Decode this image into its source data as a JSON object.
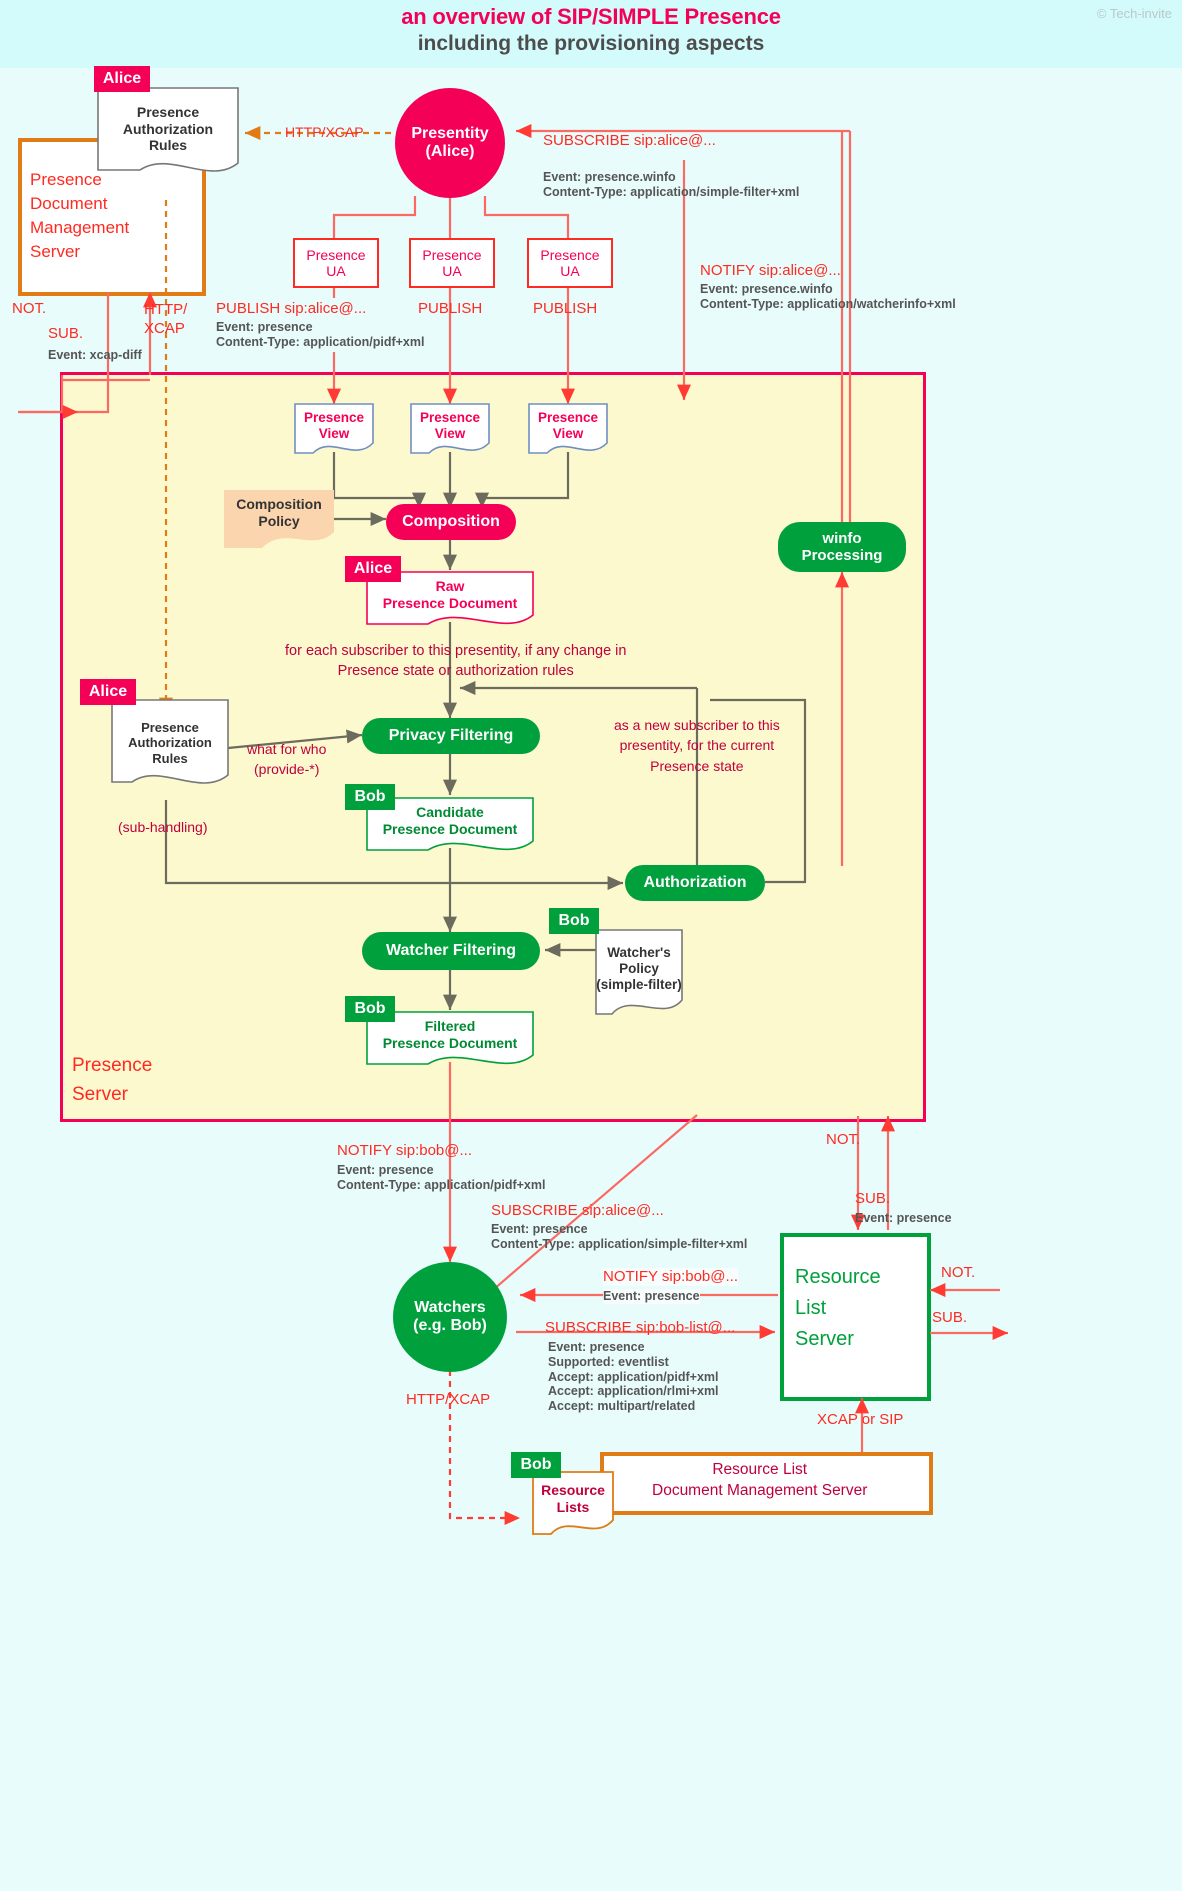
{
  "header": {
    "title_line1": "an overview of SIP/SIMPLE Presence",
    "title_line2": "including the provisioning aspects",
    "copyright": "© Tech-invite"
  },
  "nodes": {
    "presentity": "Presentity\n(Alice)",
    "presence_ua_1": "Presence\nUA",
    "presence_ua_2": "Presence\nUA",
    "presence_ua_3": "Presence\nUA",
    "presence_view_1": "Presence\nView",
    "presence_view_2": "Presence\nView",
    "presence_view_3": "Presence\nView",
    "composition_policy": "Composition\nPolicy",
    "composition": "Composition",
    "raw_presence_document": "Raw\nPresence Document",
    "presence_authorization_rules_top": "Presence\nAuthorization\nRules",
    "presence_authorization_rules_mid": "Presence\nAuthorization\nRules",
    "privacy_filtering": "Privacy Filtering",
    "candidate_presence_document": "Candidate\nPresence Document",
    "authorization": "Authorization",
    "watcher_filtering": "Watcher Filtering",
    "watchers_policy": "Watcher's\nPolicy\n(simple-filter)",
    "filtered_presence_document": "Filtered\nPresence Document",
    "winfo_processing": "winfo\nProcessing",
    "watchers": "Watchers\n(e.g. Bob)",
    "resource_list_server": "Resource\nList\nServer",
    "resource_lists": "Resource\nLists",
    "resource_list_dms": "Resource List\nDocument Management Server",
    "presence_document_management_server": "Presence\nDocument\nManagement\nServer",
    "presence_server": "Presence\nServer"
  },
  "tags": {
    "alice_1": "Alice",
    "alice_2": "Alice",
    "alice_3": "Alice",
    "bob_1": "Bob",
    "bob_2": "Bob",
    "bob_3": "Bob",
    "bob_4": "Bob"
  },
  "labels": {
    "http_xcap_top": "HTTP/XCAP",
    "subscribe_alice_winfo": "SUBSCRIBE sip:alice@...",
    "subscribe_alice_winfo_detail": "Event: presence.winfo\nContent-Type: application/simple-filter+xml",
    "notify_alice_winfo": "NOTIFY sip:alice@...",
    "notify_alice_winfo_detail": "Event: presence.winfo\nContent-Type: application/watcherinfo+xml",
    "publish_alice": "PUBLISH sip:alice@...",
    "publish_alice_detail": "Event: presence\nContent-Type: application/pidf+xml",
    "publish_2": "PUBLISH",
    "publish_3": "PUBLISH",
    "not_left": "NOT.",
    "sub_left": "SUB.",
    "sub_left_detail": "Event: xcap-diff",
    "http_xcap_left": "HTTP/\nXCAP",
    "for_each_subscriber": "for each subscriber to this presentity, if any change in\nPresence state or authorization rules",
    "as_new_subscriber": "as a new subscriber to this\npresentity, for the current\nPresence state",
    "what_for_who": "what for who\n(provide-*)",
    "sub_handling": "(sub-handling)",
    "notify_bob": "NOTIFY sip:bob@...",
    "notify_bob_detail": "Event: presence\nContent-Type: application/pidf+xml",
    "subscribe_alice_presence": "SUBSCRIBE sip:alice@...",
    "subscribe_alice_presence_detail": "Event: presence\nContent-Type: application/simple-filter+xml",
    "notify_bob_rls": "NOTIFY sip:bob@...",
    "notify_bob_rls_detail": "Event: presence",
    "subscribe_bob_list": "SUBSCRIBE sip:bob-list@...",
    "subscribe_bob_list_detail": "Event: presence\nSupported: eventlist\nAccept: application/pidf+xml\nAccept: application/rlmi+xml\nAccept: multipart/related",
    "not_rls_top": "NOT.",
    "sub_rls_top": "SUB.",
    "sub_rls_top_detail": "Event: presence",
    "not_rls_right": "NOT.",
    "sub_rls_right": "SUB.",
    "http_xcap_bottom": "HTTP/XCAP",
    "xcap_or_sip": "XCAP or SIP"
  },
  "colors": {
    "pink": "#f50057",
    "red": "#ff2a22",
    "green": "#00a03c",
    "orange": "#e07b16",
    "crimson": "#c0003c",
    "page_bg": "#e8fcfc",
    "header_bg": "#d4fbfb",
    "presence_server_bg": "#fdf9cf",
    "composition_policy_bg": "#fad5ae"
  }
}
